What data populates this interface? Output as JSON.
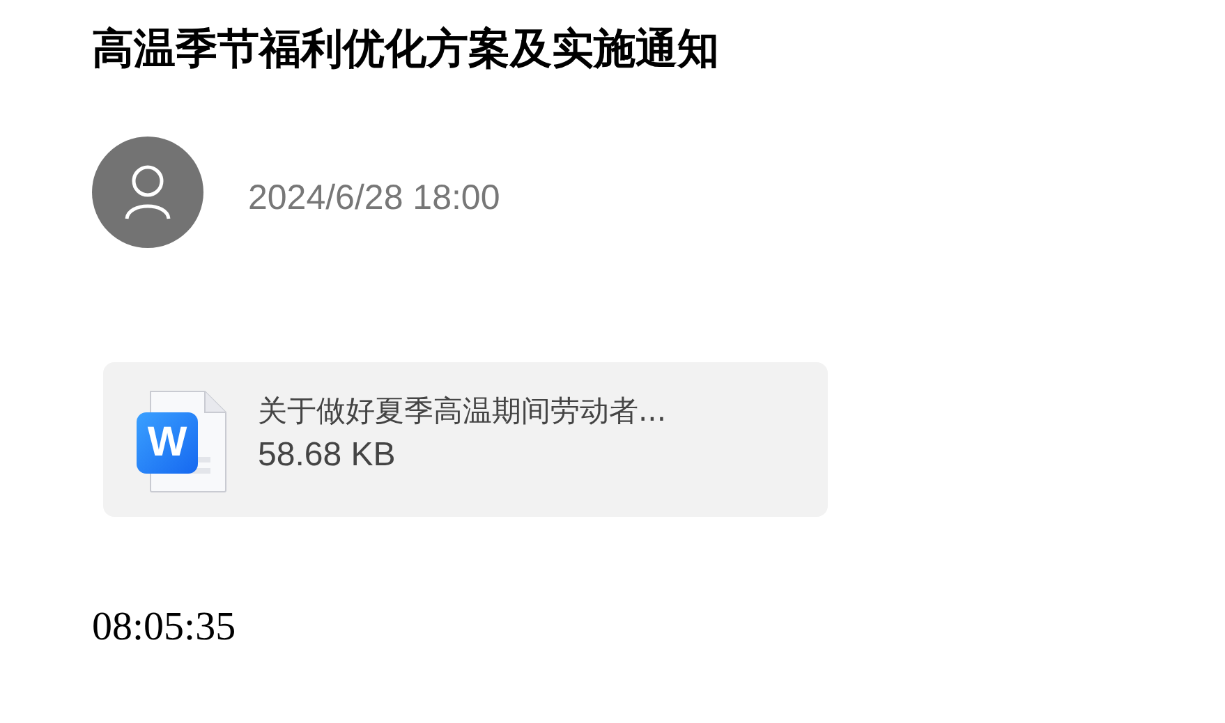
{
  "title": "高温季节福利优化方案及实施通知",
  "author": {
    "date": "2024/6/28 18:00"
  },
  "attachment": {
    "icon_letter": "W",
    "filename": "关于做好夏季高温期间劳动者...",
    "size": "58.68 KB"
  },
  "time": "08:05:35"
}
